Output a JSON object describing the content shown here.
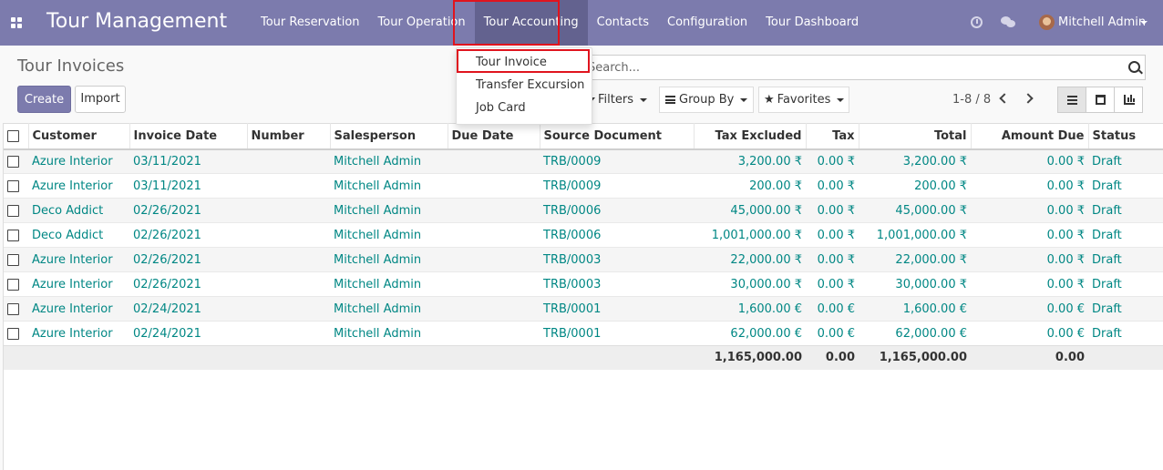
{
  "navbar": {
    "brand": "Tour Management",
    "menu": [
      "Tour Reservation",
      "Tour Operation",
      "Tour Accounting",
      "Contacts",
      "Configuration",
      "Tour Dashboard"
    ],
    "user": "Mitchell Admin"
  },
  "dropdown": {
    "items": [
      "Tour Invoice",
      "Transfer Excursion",
      "Job Card"
    ]
  },
  "control": {
    "title": "Tour Invoices",
    "create_label": "Create",
    "import_label": "Import",
    "search_placeholder": "Search...",
    "filters_label": "Filters",
    "groupby_label": "Group By",
    "favorites_label": "Favorites",
    "pager": "1-8 / 8"
  },
  "table": {
    "headers": [
      "Customer",
      "Invoice Date",
      "Number",
      "Salesperson",
      "Due Date",
      "Source Document",
      "Tax Excluded",
      "Tax",
      "Total",
      "Amount Due",
      "Status"
    ],
    "rows": [
      [
        "Azure Interior",
        "03/11/2021",
        "",
        "Mitchell Admin",
        "",
        "TRB/0009",
        "3,200.00 ₹",
        "0.00 ₹",
        "3,200.00 ₹",
        "0.00 ₹",
        "Draft"
      ],
      [
        "Azure Interior",
        "03/11/2021",
        "",
        "Mitchell Admin",
        "",
        "TRB/0009",
        "200.00 ₹",
        "0.00 ₹",
        "200.00 ₹",
        "0.00 ₹",
        "Draft"
      ],
      [
        "Deco Addict",
        "02/26/2021",
        "",
        "Mitchell Admin",
        "",
        "TRB/0006",
        "45,000.00 ₹",
        "0.00 ₹",
        "45,000.00 ₹",
        "0.00 ₹",
        "Draft"
      ],
      [
        "Deco Addict",
        "02/26/2021",
        "",
        "Mitchell Admin",
        "",
        "TRB/0006",
        "1,001,000.00 ₹",
        "0.00 ₹",
        "1,001,000.00 ₹",
        "0.00 ₹",
        "Draft"
      ],
      [
        "Azure Interior",
        "02/26/2021",
        "",
        "Mitchell Admin",
        "",
        "TRB/0003",
        "22,000.00 ₹",
        "0.00 ₹",
        "22,000.00 ₹",
        "0.00 ₹",
        "Draft"
      ],
      [
        "Azure Interior",
        "02/26/2021",
        "",
        "Mitchell Admin",
        "",
        "TRB/0003",
        "30,000.00 ₹",
        "0.00 ₹",
        "30,000.00 ₹",
        "0.00 ₹",
        "Draft"
      ],
      [
        "Azure Interior",
        "02/24/2021",
        "",
        "Mitchell Admin",
        "",
        "TRB/0001",
        "1,600.00 €",
        "0.00 €",
        "1,600.00 €",
        "0.00 €",
        "Draft"
      ],
      [
        "Azure Interior",
        "02/24/2021",
        "",
        "Mitchell Admin",
        "",
        "TRB/0001",
        "62,000.00 €",
        "0.00 €",
        "62,000.00 €",
        "0.00 €",
        "Draft"
      ]
    ],
    "totals": {
      "tax_excluded": "1,165,000.00",
      "tax": "0.00",
      "total": "1,165,000.00",
      "amount_due": "0.00"
    }
  },
  "colors": {
    "navbar": "#7c7bad",
    "active_menu": "#63628f",
    "link": "#008784",
    "highlight": "#e0141e"
  }
}
